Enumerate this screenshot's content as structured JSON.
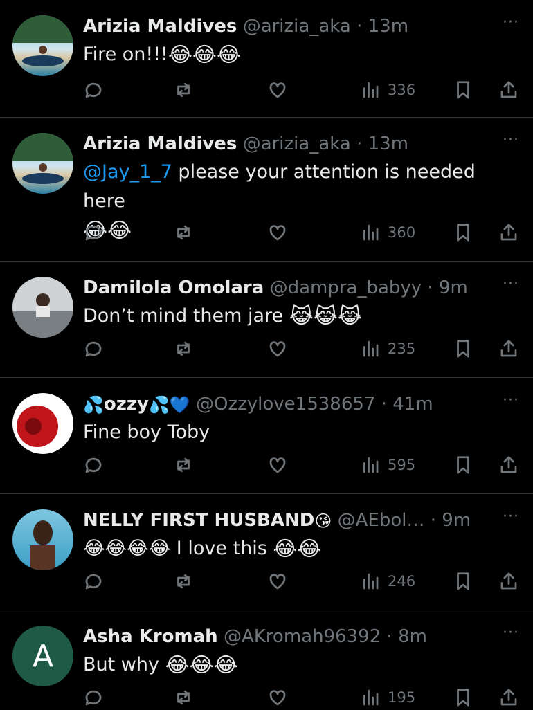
{
  "tweets": [
    {
      "name": "Arizia Maldives",
      "handle": "@arizia_aka",
      "time": "13m",
      "pre": "",
      "mention": "",
      "text": "Fire on!!!",
      "emoji": "😂😂😂",
      "views": "336",
      "more": "···"
    },
    {
      "name": "Arizia Maldives",
      "handle": "@arizia_aka",
      "time": "13m",
      "pre": "",
      "mention": "@Jay_1_7",
      "text": " please your attention is needed here",
      "emoji": "😂😂",
      "views": "360",
      "more": "···"
    },
    {
      "name": "Damilola Omolara",
      "handle": "@dampra_babyy",
      "time": "9m",
      "pre": "",
      "mention": "",
      "text": "Don’t mind them jare ",
      "emoji": "😹😹😹",
      "views": "235",
      "more": "···"
    },
    {
      "name": "ozzy",
      "handle": "@Ozzylove1538657",
      "time": "41m",
      "pre": "💦",
      "mention": "",
      "text": "Fine boy Toby",
      "emoji": "",
      "views": "595",
      "more": "···",
      "name_suffix": "💦💙"
    },
    {
      "name": "NELLY FIRST HUSBAND",
      "handle": "@AEbol…",
      "time": "9m",
      "pre": "",
      "mention": "",
      "text": "😂😂😂😂 I love this ",
      "emoji": "😂😂",
      "views": "246",
      "more": "···",
      "name_suffix": " 😘"
    },
    {
      "name": "Asha Kromah",
      "handle": "@AKromah96392",
      "time": "8m",
      "pre": "",
      "mention": "",
      "text": "But why ",
      "emoji": "😂😂😂",
      "views": "195",
      "more": "···",
      "avatar_letter": "A"
    }
  ],
  "colors": {
    "background": "#000000",
    "text": "#e7e9ea",
    "muted": "#71767b",
    "link": "#1d9bf0",
    "divider": "#2f3336"
  }
}
